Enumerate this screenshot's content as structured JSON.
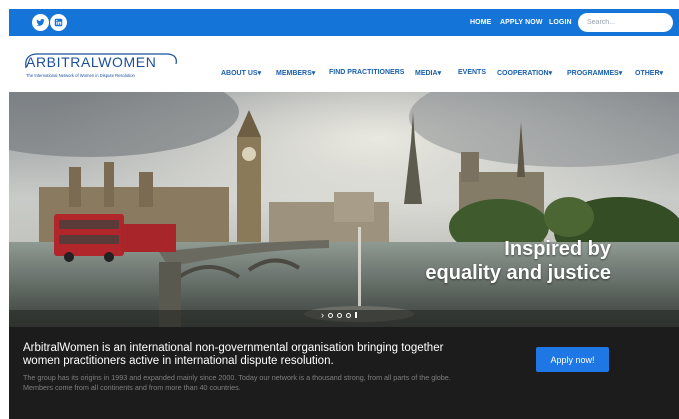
{
  "topbar": {
    "social": [
      {
        "icon": "twitter-icon"
      },
      {
        "icon": "linkedin-icon"
      }
    ],
    "links": [
      "HOME",
      "APPLY NOW",
      "LOGIN"
    ],
    "search_placeholder": "Search..."
  },
  "header": {
    "logo_text": "ARBITRALWOMEN",
    "logo_tagline": "The International Network of Women in Dispute Resolution",
    "nav": [
      {
        "label": "ABOUT US",
        "dropdown": true
      },
      {
        "label": "MEMBERS",
        "dropdown": true
      },
      {
        "label": "FIND PRACTITIONERS",
        "dropdown": false
      },
      {
        "label": "MEDIA",
        "dropdown": true
      },
      {
        "label": "EVENTS",
        "dropdown": false
      },
      {
        "label": "COOPERATION",
        "dropdown": true
      },
      {
        "label": "PROGRAMMES",
        "dropdown": true
      },
      {
        "label": "OTHER",
        "dropdown": true
      }
    ]
  },
  "hero": {
    "headline_line1": "Inspired by",
    "headline_line2": "equality and justice",
    "slider_next": "›"
  },
  "band": {
    "main_text": "ArbitralWomen is an international non-governmental organisation bringing together women practitioners active in international dispute resolution.",
    "sub_text": "The group has its origins in 1993 and expanded mainly since 2000. Today our network is a thousand strong, from all parts of the globe. Members come from all continents and from more than 40 countries.",
    "cta": "Apply now!"
  },
  "colors": {
    "topbar": "#1474d8",
    "brand_blue": "#1a4f9c",
    "nav_blue": "#1a5fae",
    "band_bg": "#1c1c1c",
    "cta_bg": "#1f77e6"
  }
}
